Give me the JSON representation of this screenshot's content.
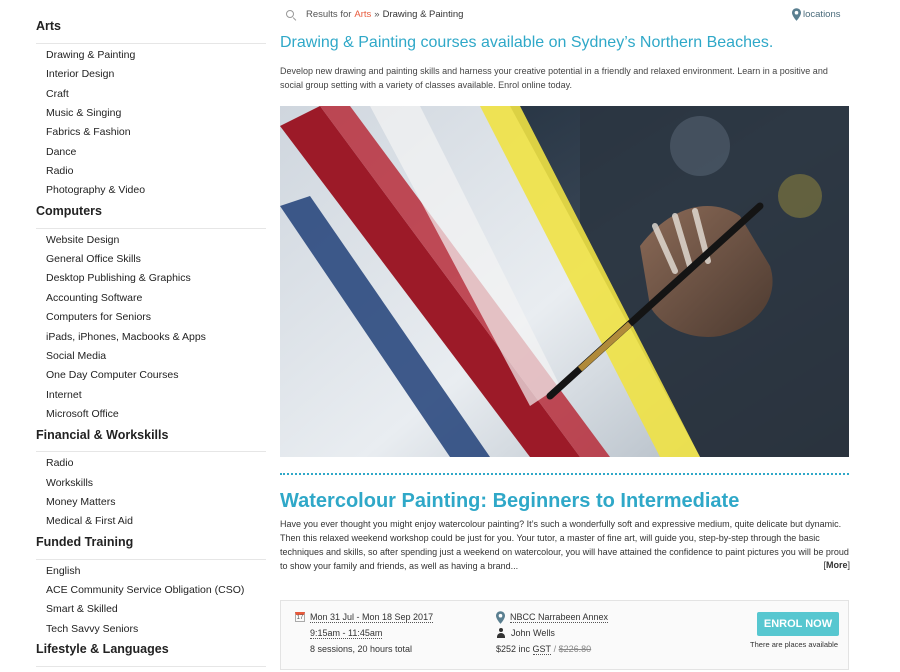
{
  "sidebar": {
    "categories": [
      {
        "title": "Arts",
        "items": [
          "Drawing & Painting",
          "Interior Design",
          "Craft",
          "Music & Singing",
          "Fabrics & Fashion",
          "Dance",
          "Radio",
          "Photography & Video"
        ]
      },
      {
        "title": "Computers",
        "items": [
          "Website Design",
          "General Office Skills",
          "Desktop Publishing & Graphics",
          "Accounting Software",
          "Computers for Seniors",
          "iPads, iPhones, Macbooks & Apps",
          "Social Media",
          "One Day Computer Courses",
          "Internet",
          "Microsoft Office"
        ]
      },
      {
        "title": "Financial & Workskills",
        "items": [
          "Radio",
          "Workskills",
          "Money Matters",
          "Medical & First Aid"
        ]
      },
      {
        "title": "Funded Training",
        "items": [
          "English",
          "ACE Community Service Obligation (CSO)",
          "Smart & Skilled",
          "Tech Savvy Seniors"
        ]
      },
      {
        "title": "Lifestyle & Languages",
        "items": []
      }
    ]
  },
  "breadcrumb": {
    "prefix": "Results for",
    "category": "Arts",
    "separator": "»",
    "current": "Drawing & Painting"
  },
  "locations_label": "locations",
  "page_title": "Drawing & Painting courses available on Sydney’s Northern Beaches.",
  "intro": "Develop new drawing and painting skills and harness your creative potential in a friendly and relaxed environment. Learn in a positive and social group setting with a variety of classes available. Enrol online today.",
  "course": {
    "title": "Watercolour Painting: Beginners to Intermediate",
    "description": "Have you ever thought you might enjoy watercolour painting? It’s such a wonderfully soft and expressive medium, quite delicate but dynamic. Then this relaxed weekend workshop could be just for you. Your tutor, a master of fine art, will guide you, step-by-step through the basic techniques and skills, so after spending just a weekend on watercolour, you will have attained the confidence to paint pictures you will be proud to show your family and friends, as well as having a brand...",
    "more_label": "More",
    "dates": "Mon 31 Jul - Mon 18 Sep 2017",
    "time": "9:15am - 11:45am",
    "sessions": "8 sessions, 20 hours total",
    "venue": "NBCC Narrabeen Annex",
    "tutor": "John Wells",
    "price": "$252 inc",
    "gst": "GST",
    "price_sep": "/",
    "full_price": "$226.80",
    "enrol_label": "ENROL NOW",
    "availability": "There are places available",
    "calendar_glyph": "17"
  },
  "colors": {
    "accent": "#2fa8c8",
    "button": "#57c7d0",
    "highlight": "#e85a3c"
  }
}
